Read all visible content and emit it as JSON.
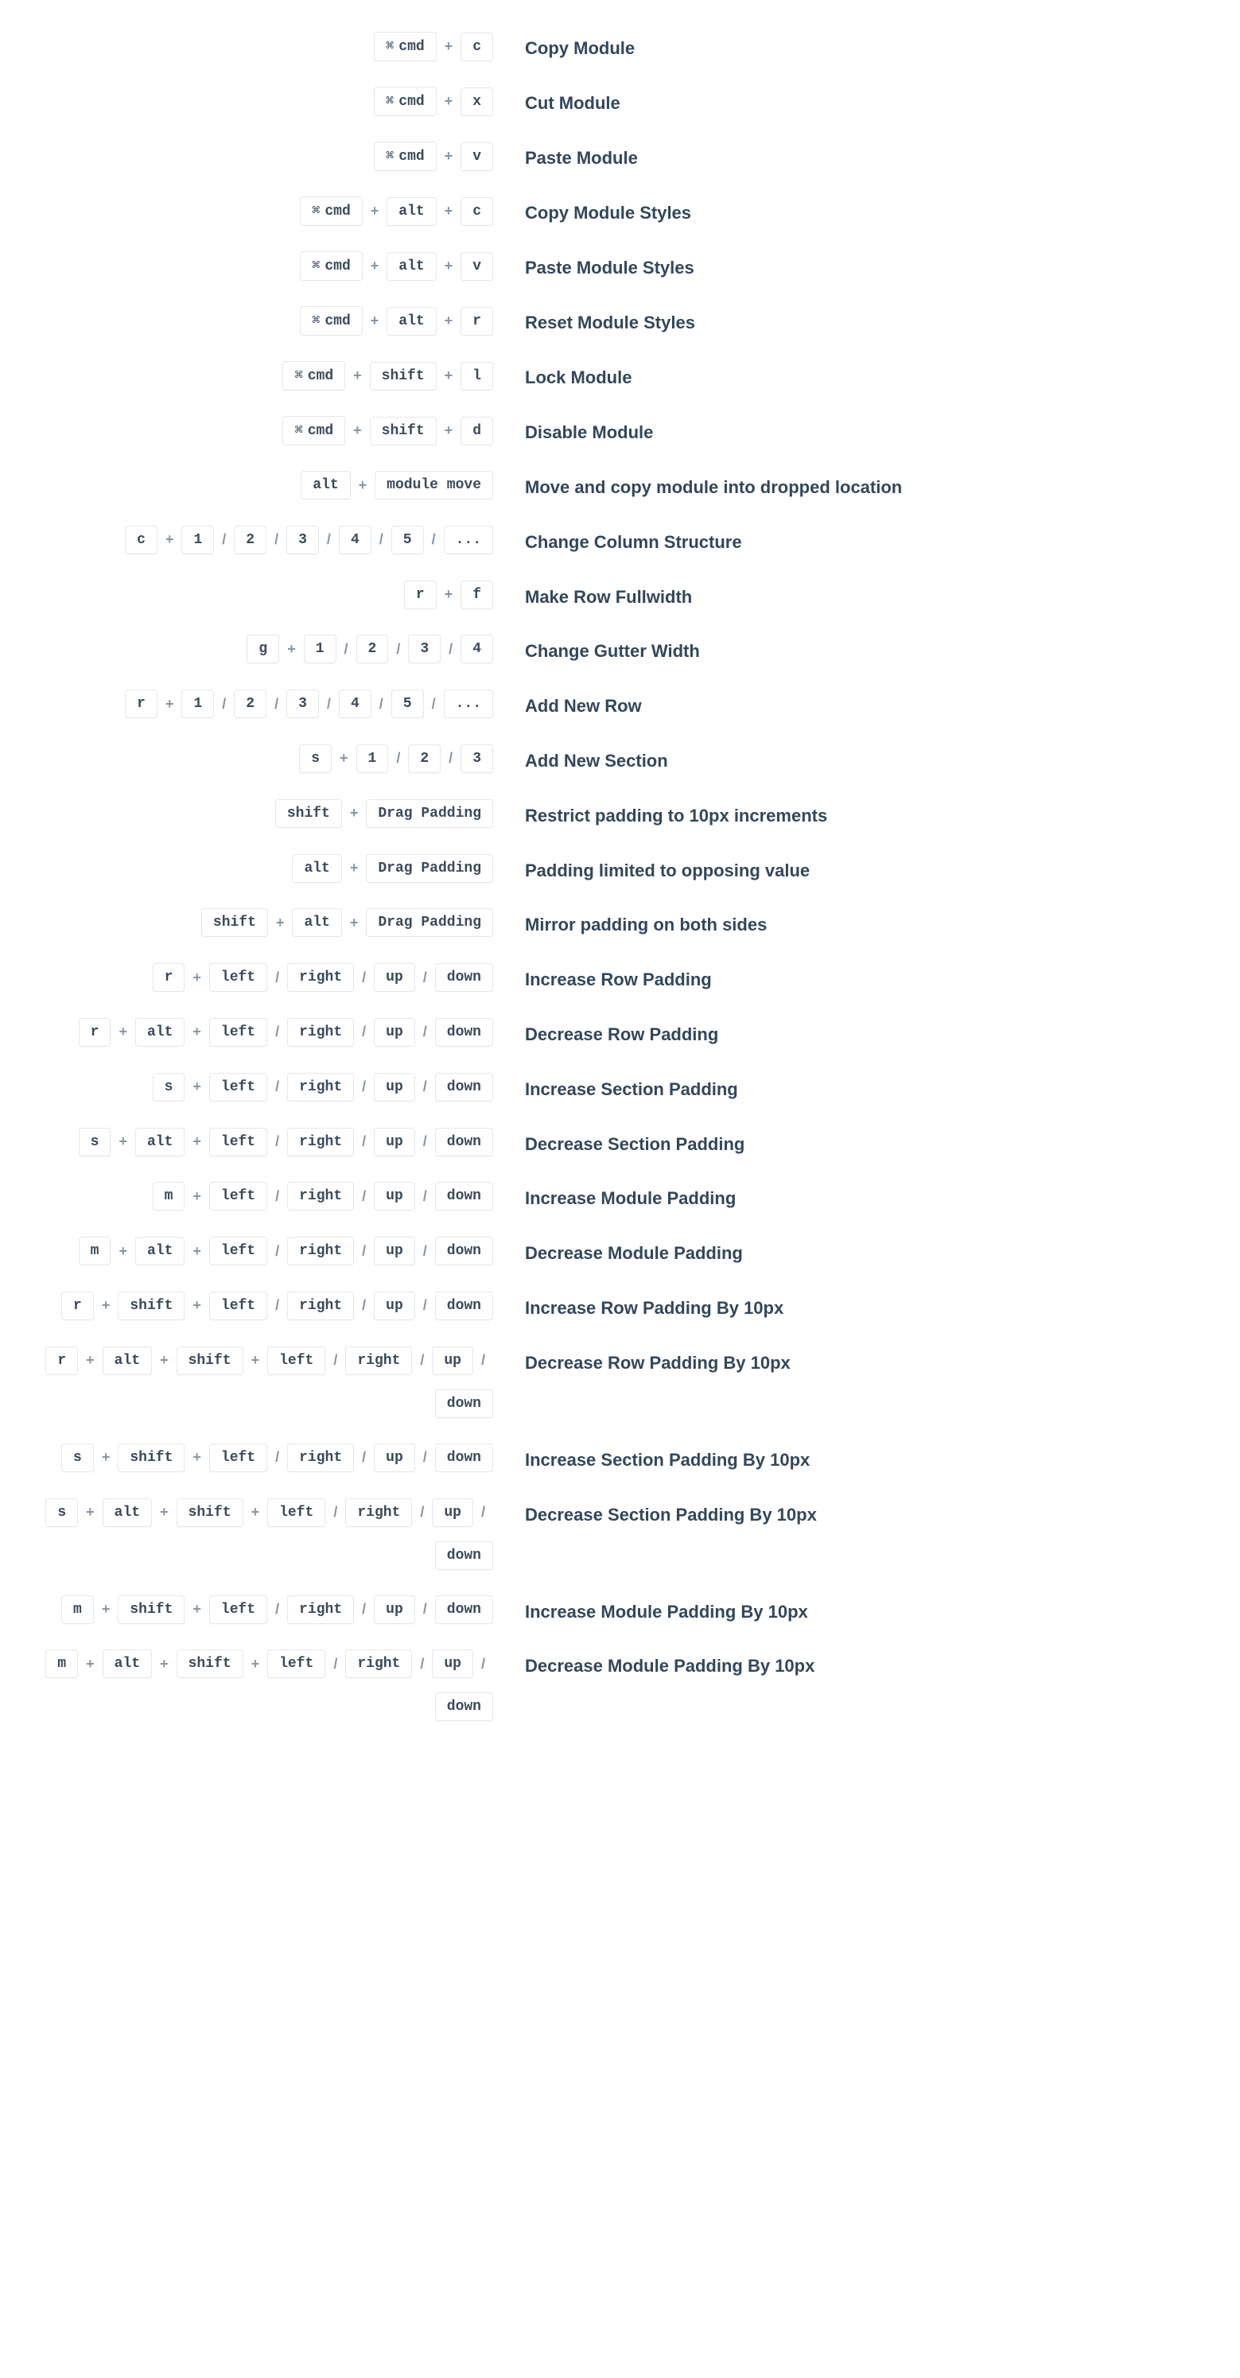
{
  "shortcuts": [
    {
      "keys": [
        [
          "cmd"
        ],
        "+",
        [
          "c"
        ]
      ],
      "desc": "Copy Module"
    },
    {
      "keys": [
        [
          "cmd"
        ],
        "+",
        [
          "x"
        ]
      ],
      "desc": "Cut Module"
    },
    {
      "keys": [
        [
          "cmd"
        ],
        "+",
        [
          "v"
        ]
      ],
      "desc": "Paste Module"
    },
    {
      "keys": [
        [
          "cmd"
        ],
        "+",
        [
          "alt"
        ],
        "+",
        [
          "c"
        ]
      ],
      "desc": "Copy Module Styles"
    },
    {
      "keys": [
        [
          "cmd"
        ],
        "+",
        [
          "alt"
        ],
        "+",
        [
          "v"
        ]
      ],
      "desc": "Paste Module Styles"
    },
    {
      "keys": [
        [
          "cmd"
        ],
        "+",
        [
          "alt"
        ],
        "+",
        [
          "r"
        ]
      ],
      "desc": "Reset Module Styles"
    },
    {
      "keys": [
        [
          "cmd"
        ],
        "+",
        [
          "shift"
        ],
        "+",
        [
          "l"
        ]
      ],
      "desc": "Lock Module"
    },
    {
      "keys": [
        [
          "cmd"
        ],
        "+",
        [
          "shift"
        ],
        "+",
        [
          "d"
        ]
      ],
      "desc": "Disable Module"
    },
    {
      "keys": [
        [
          "alt"
        ],
        "+",
        [
          "module move"
        ]
      ],
      "desc": "Move and copy module into dropped location"
    },
    {
      "keys": [
        [
          "c"
        ],
        "+",
        [
          "1"
        ],
        "/",
        [
          "2"
        ],
        "/",
        [
          "3"
        ],
        "/",
        [
          "4"
        ],
        "/",
        [
          "5"
        ],
        "/",
        [
          "..."
        ]
      ],
      "desc": "Change Column Structure"
    },
    {
      "keys": [
        [
          "r"
        ],
        "+",
        [
          "f"
        ]
      ],
      "desc": "Make Row Fullwidth"
    },
    {
      "keys": [
        [
          "g"
        ],
        "+",
        [
          "1"
        ],
        "/",
        [
          "2"
        ],
        "/",
        [
          "3"
        ],
        "/",
        [
          "4"
        ]
      ],
      "desc": "Change Gutter Width"
    },
    {
      "keys": [
        [
          "r"
        ],
        "+",
        [
          "1"
        ],
        "/",
        [
          "2"
        ],
        "/",
        [
          "3"
        ],
        "/",
        [
          "4"
        ],
        "/",
        [
          "5"
        ],
        "/",
        [
          "..."
        ]
      ],
      "desc": "Add New Row"
    },
    {
      "keys": [
        [
          "s"
        ],
        "+",
        [
          "1"
        ],
        "/",
        [
          "2"
        ],
        "/",
        [
          "3"
        ]
      ],
      "desc": "Add New Section"
    },
    {
      "keys": [
        [
          "shift"
        ],
        "+",
        [
          "Drag Padding"
        ]
      ],
      "desc": "Restrict padding to 10px increments"
    },
    {
      "keys": [
        [
          "alt"
        ],
        "+",
        [
          "Drag Padding"
        ]
      ],
      "desc": "Padding limited to opposing value"
    },
    {
      "keys": [
        [
          "shift"
        ],
        "+",
        [
          "alt"
        ],
        "+",
        [
          "Drag Padding"
        ]
      ],
      "desc": "Mirror padding on both sides"
    },
    {
      "keys": [
        [
          "r"
        ],
        "+",
        [
          "left"
        ],
        "/",
        [
          "right"
        ],
        "/",
        [
          "up"
        ],
        "/",
        [
          "down"
        ]
      ],
      "desc": "Increase Row Padding"
    },
    {
      "keys": [
        [
          "r"
        ],
        "+",
        [
          "alt"
        ],
        "+",
        [
          "left"
        ],
        "/",
        [
          "right"
        ],
        "/",
        [
          "up"
        ],
        "/",
        [
          "down"
        ]
      ],
      "desc": "Decrease Row Padding"
    },
    {
      "keys": [
        [
          "s"
        ],
        "+",
        [
          "left"
        ],
        "/",
        [
          "right"
        ],
        "/",
        [
          "up"
        ],
        "/",
        [
          "down"
        ]
      ],
      "desc": "Increase Section Padding"
    },
    {
      "keys": [
        [
          "s"
        ],
        "+",
        [
          "alt"
        ],
        "+",
        [
          "left"
        ],
        "/",
        [
          "right"
        ],
        "/",
        [
          "up"
        ],
        "/",
        [
          "down"
        ]
      ],
      "desc": "Decrease Section Padding"
    },
    {
      "keys": [
        [
          "m"
        ],
        "+",
        [
          "left"
        ],
        "/",
        [
          "right"
        ],
        "/",
        [
          "up"
        ],
        "/",
        [
          "down"
        ]
      ],
      "desc": "Increase Module Padding"
    },
    {
      "keys": [
        [
          "m"
        ],
        "+",
        [
          "alt"
        ],
        "+",
        [
          "left"
        ],
        "/",
        [
          "right"
        ],
        "/",
        [
          "up"
        ],
        "/",
        [
          "down"
        ]
      ],
      "desc": "Decrease Module Padding"
    },
    {
      "keys": [
        [
          "r"
        ],
        "+",
        [
          "shift"
        ],
        "+",
        [
          "left"
        ],
        "/",
        [
          "right"
        ],
        "/",
        [
          "up"
        ],
        "/",
        [
          "down"
        ]
      ],
      "desc": "Increase Row Padding By 10px"
    },
    {
      "keys": [
        [
          "r"
        ],
        "+",
        [
          "alt"
        ],
        "+",
        [
          "shift"
        ],
        "+",
        [
          "left"
        ],
        "/",
        [
          "right"
        ],
        "/",
        [
          "up"
        ],
        "/",
        [
          "down"
        ]
      ],
      "desc": "Decrease Row Padding By 10px"
    },
    {
      "keys": [
        [
          "s"
        ],
        "+",
        [
          "shift"
        ],
        "+",
        [
          "left"
        ],
        "/",
        [
          "right"
        ],
        "/",
        [
          "up"
        ],
        "/",
        [
          "down"
        ]
      ],
      "desc": "Increase Section Padding By 10px"
    },
    {
      "keys": [
        [
          "s"
        ],
        "+",
        [
          "alt"
        ],
        "+",
        [
          "shift"
        ],
        "+",
        [
          "left"
        ],
        "/",
        [
          "right"
        ],
        "/",
        [
          "up"
        ],
        "/",
        [
          "down"
        ]
      ],
      "desc": "Decrease Section Padding By 10px"
    },
    {
      "keys": [
        [
          "m"
        ],
        "+",
        [
          "shift"
        ],
        "+",
        [
          "left"
        ],
        "/",
        [
          "right"
        ],
        "/",
        [
          "up"
        ],
        "/",
        [
          "down"
        ]
      ],
      "desc": "Increase Module Padding By 10px"
    },
    {
      "keys": [
        [
          "m"
        ],
        "+",
        [
          "alt"
        ],
        "+",
        [
          "shift"
        ],
        "+",
        [
          "left"
        ],
        "/",
        [
          "right"
        ],
        "/",
        [
          "up"
        ],
        "/",
        [
          "down"
        ]
      ],
      "desc": "Decrease Module Padding By 10px"
    }
  ]
}
